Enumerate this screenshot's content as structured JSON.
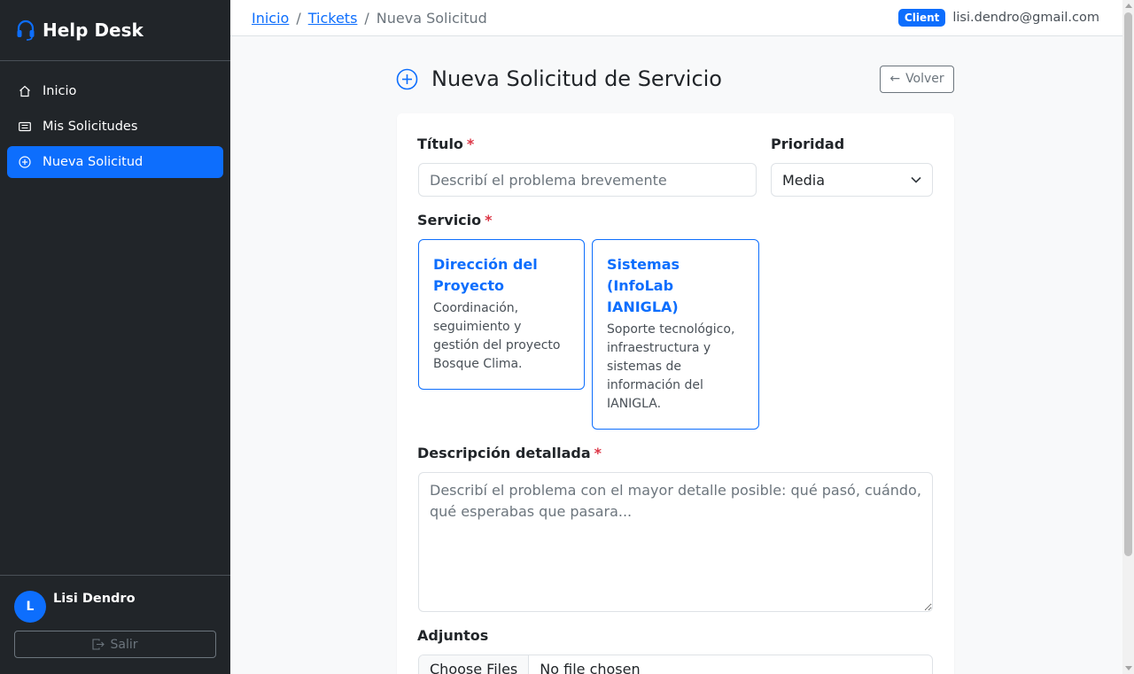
{
  "app": {
    "brand": "Help Desk",
    "accent_color": "#0d6efd",
    "sidebar_bg": "#212529"
  },
  "sidebar": {
    "items": [
      {
        "label": "Inicio",
        "icon": "house-icon"
      },
      {
        "label": "Mis Solicitudes",
        "icon": "ticket-icon"
      },
      {
        "label": "Nueva Solicitud",
        "icon": "plus-circle-icon",
        "active": true
      }
    ],
    "user": {
      "initial": "L",
      "name": "Lisi Dendro"
    },
    "logout_label": "Salir"
  },
  "topbar": {
    "breadcrumb": [
      "Inicio",
      "Tickets",
      "Nueva Solicitud"
    ],
    "role_badge": "Client",
    "email": "lisi.dendro@gmail.com"
  },
  "page": {
    "title": "Nueva Solicitud de Servicio",
    "back_label": "Volver"
  },
  "form": {
    "title_label": "Título",
    "title_placeholder": "Describí el problema brevemente",
    "priority_label": "Prioridad",
    "priority_value": "Media",
    "service_label": "Servicio",
    "services": [
      {
        "title": "Dirección del Proyecto",
        "description": "Coordinación, seguimiento y gestión del proyecto Bosque Clima."
      },
      {
        "title": "Sistemas (InfoLab IANIGLA)",
        "description": "Soporte tecnológico, infraestructura y sistemas de información del IANIGLA."
      }
    ],
    "description_label": "Descripción detallada",
    "description_placeholder": "Describí el problema con el mayor detalle posible: qué pasó, cuándo, qué esperabas que pasara...",
    "attachments_label": "Adjuntos",
    "file_button": "Choose Files",
    "file_status": "No file chosen",
    "required_mark": "*"
  }
}
